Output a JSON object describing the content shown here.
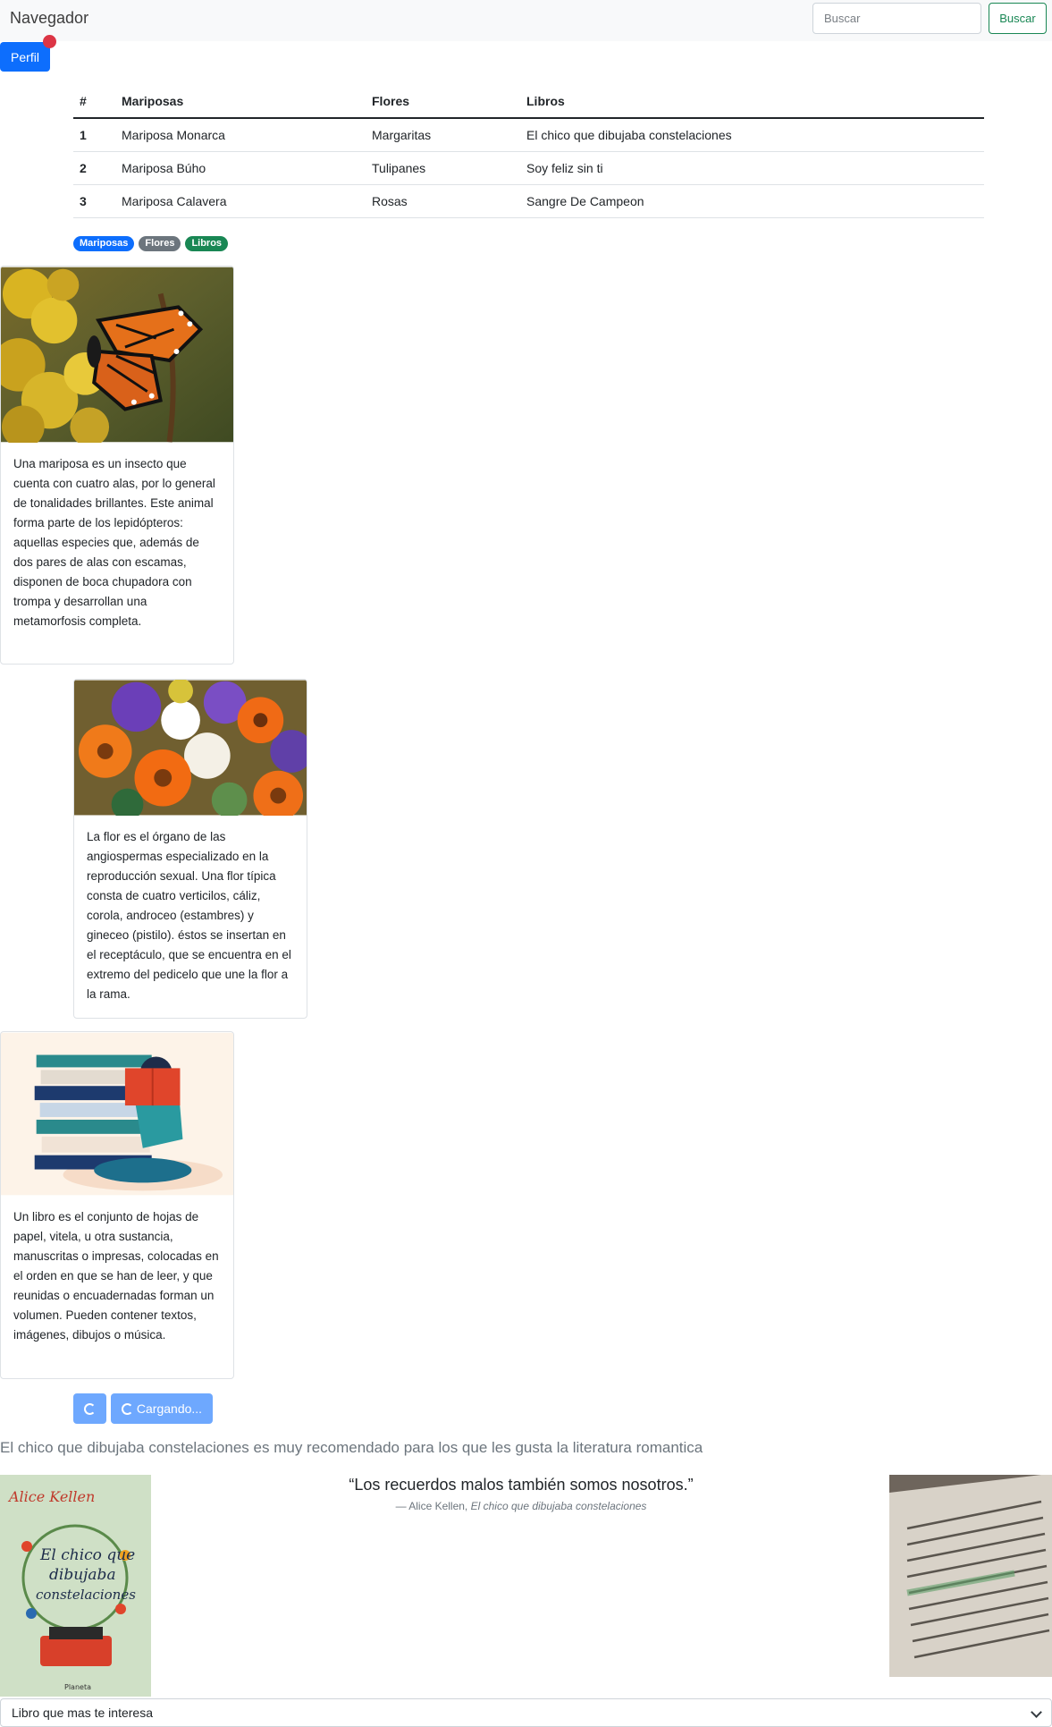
{
  "navbar": {
    "brand": "Navegador",
    "search_placeholder": "Buscar",
    "search_button": "Buscar"
  },
  "profile_button": "Perfil",
  "table": {
    "headers": [
      "#",
      "Mariposas",
      "Flores",
      "Libros"
    ],
    "rows": [
      [
        "1",
        "Mariposa Monarca",
        "Margaritas",
        "El chico que dibujaba constelaciones"
      ],
      [
        "2",
        "Mariposa Búho",
        "Tulipanes",
        "Soy feliz sin ti"
      ],
      [
        "3",
        "Mariposa Calavera",
        "Rosas",
        "Sangre De Campeon"
      ]
    ]
  },
  "badges": [
    {
      "label": "Mariposas",
      "color": "#0d6efd"
    },
    {
      "label": "Flores",
      "color": "#6c757d"
    },
    {
      "label": "Libros",
      "color": "#198754"
    }
  ],
  "cards": [
    {
      "image": "butterfly-photo",
      "text": "Una mariposa es un insecto que cuenta con cuatro alas, por lo general de tonalidades brillantes. Este animal forma parte de los lepidópteros: aquellas especies que, además de dos pares de alas con escamas, disponen de boca chupadora con trompa y desarrollan una metamorfosis completa."
    },
    {
      "image": "flowers-photo",
      "text": "La flor es el órgano de las angiospermas especializado en la reproducción sexual. Una flor típica consta de cuatro verticilos, cáliz, corola, androceo (estambres) y gineceo (pistilo). éstos se insertan en el receptáculo, que se encuentra en el extremo del pedicelo que une la flor a la rama."
    },
    {
      "image": "books-illustration",
      "text": "Un libro es el conjunto de hojas de papel, vitela, u otra sustancia, manuscritas o impresas, colocadas en el orden en que se han de leer, y que reunidas o encuadernadas forman un volumen. Pueden contener textos, imágenes, dibujos o música."
    }
  ],
  "loading_button": "Cargando...",
  "recommendation": "El chico que dibujaba constelaciones es muy recomendado para los que les gusta la literatura romantica",
  "quote": {
    "text": "“Los recuerdos malos también somos nosotros.”",
    "author": "— Alice Kellen,",
    "source": "El chico que dibujaba constelaciones"
  },
  "book_cover": {
    "author": "Alice Kellen",
    "title_lines": [
      "El chico que",
      "dibujaba",
      "constelaciones"
    ],
    "publisher": "Planeta"
  },
  "select": {
    "selected": "Libro que mas te interesa"
  },
  "colors": {
    "primary": "#0d6efd",
    "success": "#198754",
    "danger": "#dc3545",
    "secondary": "#6c757d"
  }
}
